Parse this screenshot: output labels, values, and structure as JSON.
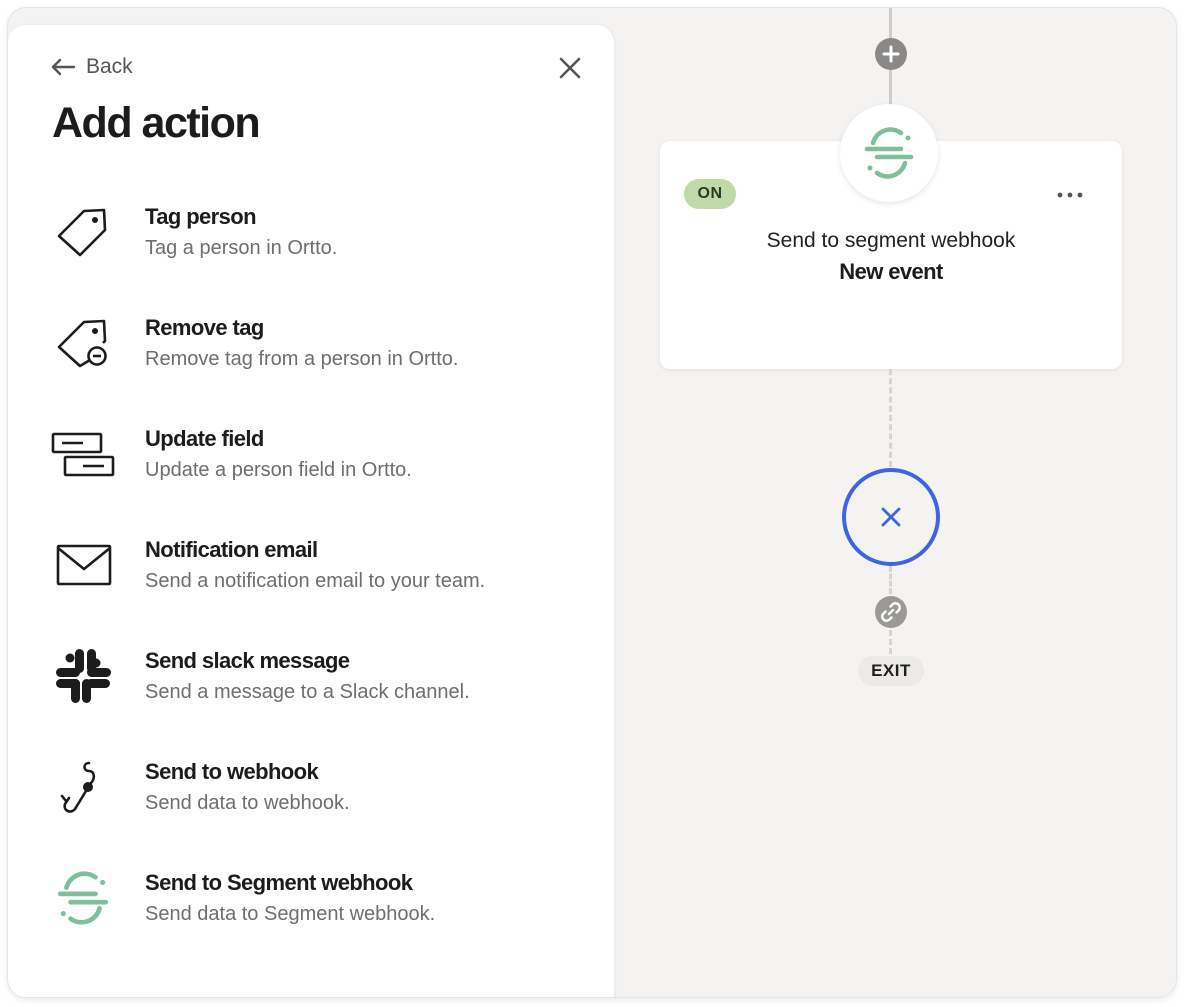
{
  "panel": {
    "back_label": "Back",
    "title": "Add action",
    "actions": [
      {
        "name": "Tag person",
        "desc": "Tag a person in Ortto.",
        "icon": "tag-icon"
      },
      {
        "name": "Remove tag",
        "desc": "Remove tag from a person in Ortto.",
        "icon": "tag-remove-icon"
      },
      {
        "name": "Update field",
        "desc": "Update a person field in Ortto.",
        "icon": "update-field-icon"
      },
      {
        "name": "Notification email",
        "desc": "Send a notification email to your team.",
        "icon": "envelope-icon"
      },
      {
        "name": "Send slack message",
        "desc": "Send a message to a Slack channel.",
        "icon": "slack-icon"
      },
      {
        "name": "Send to webhook",
        "desc": "Send data to webhook.",
        "icon": "webhook-icon"
      },
      {
        "name": "Send to Segment webhook",
        "desc": "Send data to Segment webhook.",
        "icon": "segment-icon"
      }
    ]
  },
  "flow": {
    "card": {
      "status": "ON",
      "title": "Send to segment webhook",
      "subtitle": "New event"
    },
    "exit_label": "EXIT"
  },
  "colors": {
    "segment_green": "#7fbf9b",
    "on_badge_bg": "#bfd9a8",
    "exit_ring": "#3f63e5",
    "canvas_bg": "#f4f3f1"
  }
}
